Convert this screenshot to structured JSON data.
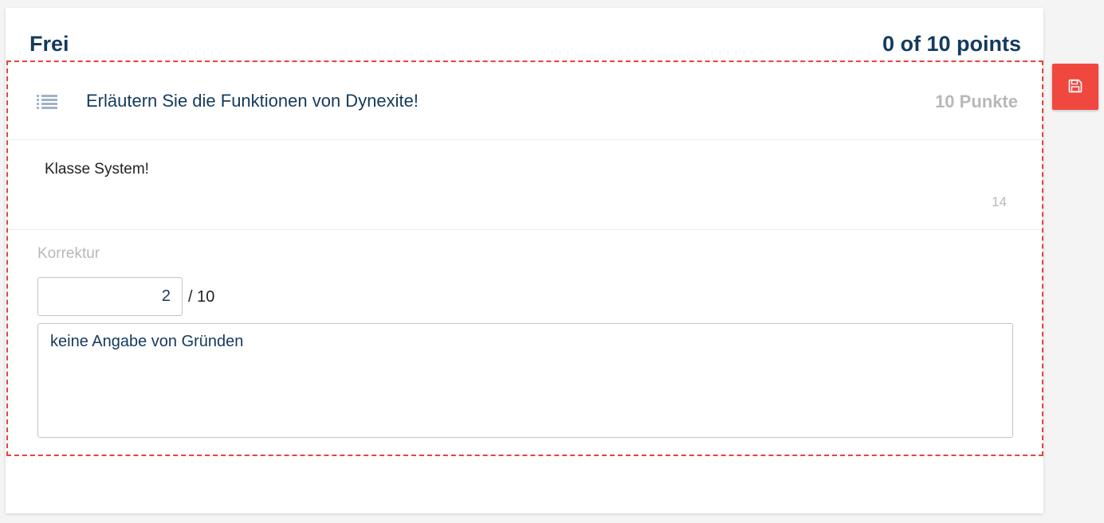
{
  "section": {
    "title": "Frei",
    "points_summary": "0 of 10 points"
  },
  "question": {
    "icon": "list-icon",
    "text": "Erläutern Sie die Funktionen von Dynexite!",
    "points": "10 Punkte"
  },
  "answer": {
    "text": "Klasse System!",
    "char_count": "14"
  },
  "correction": {
    "label": "Korrektur",
    "score_value": "2",
    "score_max": "/ 10",
    "comment": "keine Angabe von Gründen"
  },
  "save_button": {
    "icon": "save-icon"
  },
  "colors": {
    "accent": "#f0473f",
    "title": "#143a5e",
    "muted": "#b8b8b8"
  }
}
